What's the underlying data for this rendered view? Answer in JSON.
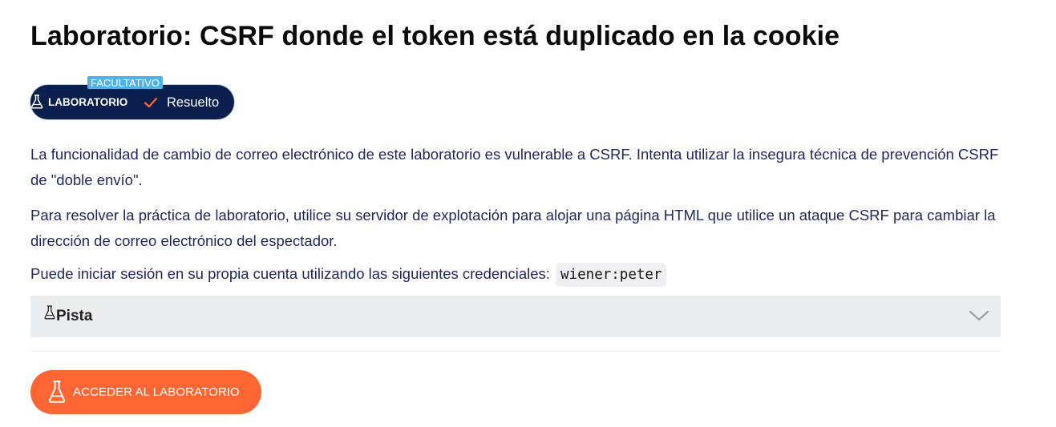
{
  "page": {
    "title": "Laboratorio: CSRF donde el token está duplicado en la cookie"
  },
  "badges": {
    "optional": "FACULTATIVO",
    "lab": "LABORATORIO",
    "status": "Resuelto",
    "icons": {
      "lab": "flask-icon",
      "status": "checkmark-icon"
    },
    "colors": {
      "lab_background": "#0b1f4f",
      "optional_background": "#4fb3ea",
      "status_check": "#ff6633"
    }
  },
  "description": {
    "paragraph_1": "La funcionalidad de cambio de correo electrónico de este laboratorio es vulnerable a CSRF. Intenta utilizar la insegura técnica de prevención CSRF de \"doble envío\".",
    "paragraph_2": "Para resolver la práctica de laboratorio, utilice su servidor de explotación para alojar una página HTML que utilice un ataque CSRF para cambiar la dirección de correo electrónico del espectador.",
    "paragraph_3": "Puede iniciar sesión en su propia cuenta utilizando las siguientes credenciales:",
    "credentials": "wiener:peter"
  },
  "hint": {
    "label": "Pista",
    "icon": "flask-icon",
    "toggle_icon": "chevron-down-icon",
    "expanded": false
  },
  "actions": {
    "access_lab_label": "ACCEDER AL LABORATORIO",
    "access_lab_icon": "flask-icon",
    "accent_color": "#ff6633"
  }
}
